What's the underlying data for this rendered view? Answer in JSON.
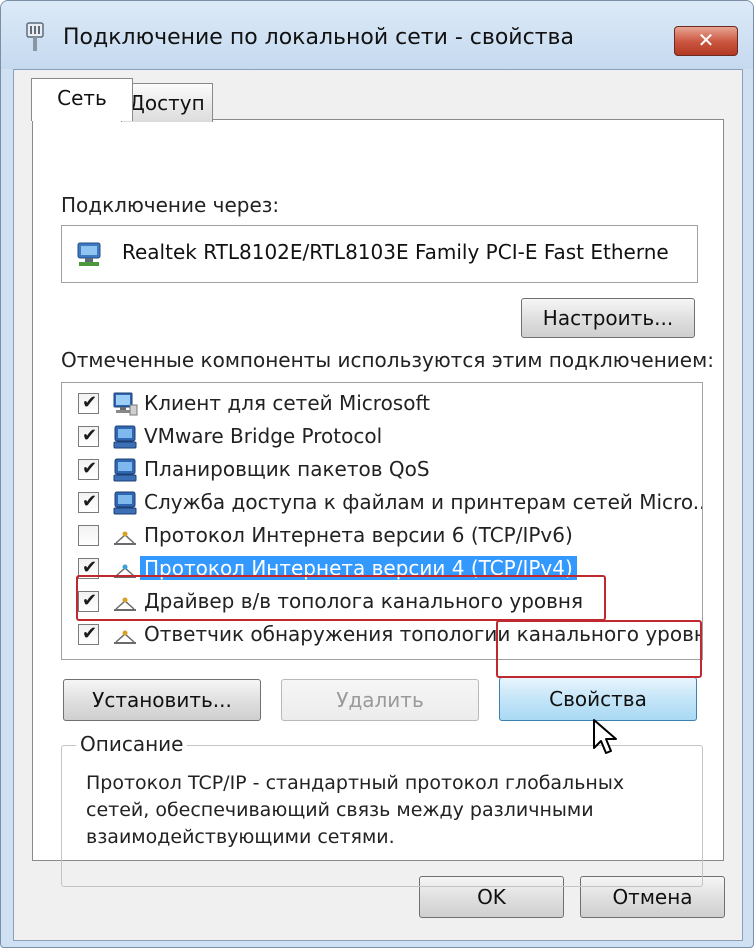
{
  "window": {
    "title": "Подключение по локальной сети - свойства",
    "close_label": "✕"
  },
  "tabs": [
    {
      "label": "Сеть",
      "active": true
    },
    {
      "label": "Доступ",
      "active": false
    }
  ],
  "connection": {
    "label": "Подключение через:",
    "adapter": "Realtek RTL8102E/RTL8103E Family PCI-E Fast Etherne",
    "configure_button": "Настроить..."
  },
  "components": {
    "label": "Отмеченные компоненты используются этим подключением:",
    "items": [
      {
        "label": "Клиент для сетей Microsoft",
        "checked": true,
        "icon": "network-client-icon",
        "selected": false
      },
      {
        "label": "VMware Bridge Protocol",
        "checked": true,
        "icon": "network-service-icon",
        "selected": false
      },
      {
        "label": "Планировщик пакетов QoS",
        "checked": true,
        "icon": "network-service-icon",
        "selected": false
      },
      {
        "label": "Служба доступа к файлам и принтерам сетей Micro...",
        "checked": true,
        "icon": "network-service-icon",
        "selected": false
      },
      {
        "label": "Протокол Интернета версии 6 (TCP/IPv6)",
        "checked": false,
        "icon": "protocol-icon",
        "selected": false
      },
      {
        "label": "Протокол Интернета версии 4 (TCP/IPv4)",
        "checked": true,
        "icon": "protocol-icon",
        "selected": true
      },
      {
        "label": "Драйвер в/в тополога канального уровня",
        "checked": true,
        "icon": "protocol-icon",
        "selected": false
      },
      {
        "label": "Ответчик обнаружения топологии канального уровня",
        "checked": true,
        "icon": "protocol-icon",
        "selected": false
      }
    ]
  },
  "actions": {
    "install": "Установить...",
    "remove": "Удалить",
    "properties": "Свойства"
  },
  "description": {
    "title": "Описание",
    "text": "Протокол TCP/IP - стандартный протокол глобальных\nсетей, обеспечивающий связь между различными\nвзаимодействующими сетями."
  },
  "footer": {
    "ok": "OK",
    "cancel": "Отмена"
  },
  "colors": {
    "selection": "#3399ff",
    "highlight_frame": "#c0282f",
    "close_button": "#c9533d"
  }
}
